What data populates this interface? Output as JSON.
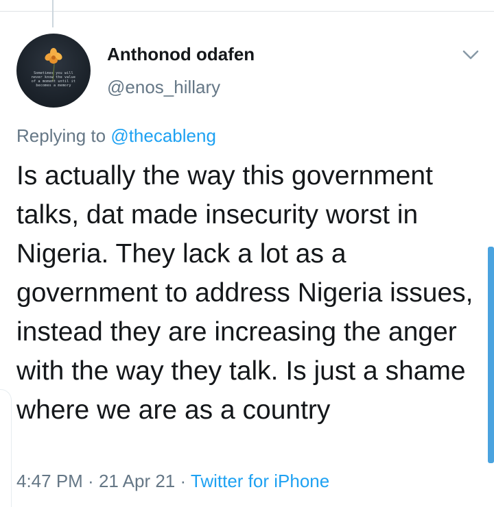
{
  "tweet": {
    "author": {
      "display_name": "Anthonod odafen",
      "handle": "@enos_hillary",
      "avatar_quote": "Sometimes you will never know the value of a moment until it becomes a memory"
    },
    "reply": {
      "prefix": "Replying to ",
      "mention": "@thecableng"
    },
    "text": "Is actually the way this government talks, dat made insecurity worst in Nigeria. They lack a lot as a government to address Nigeria issues, instead they are increasing the anger with the way they talk. Is just a shame where we are as a country",
    "meta": {
      "time": "4:47 PM",
      "separator": " · ",
      "date": "21 Apr 21",
      "source": "Twitter for iPhone"
    }
  },
  "colors": {
    "text_primary": "#14171a",
    "text_secondary": "#657786",
    "accent": "#1da1f2",
    "scrollbar": "#4aa3df"
  },
  "icons": {
    "more": "chevron-down-icon"
  }
}
